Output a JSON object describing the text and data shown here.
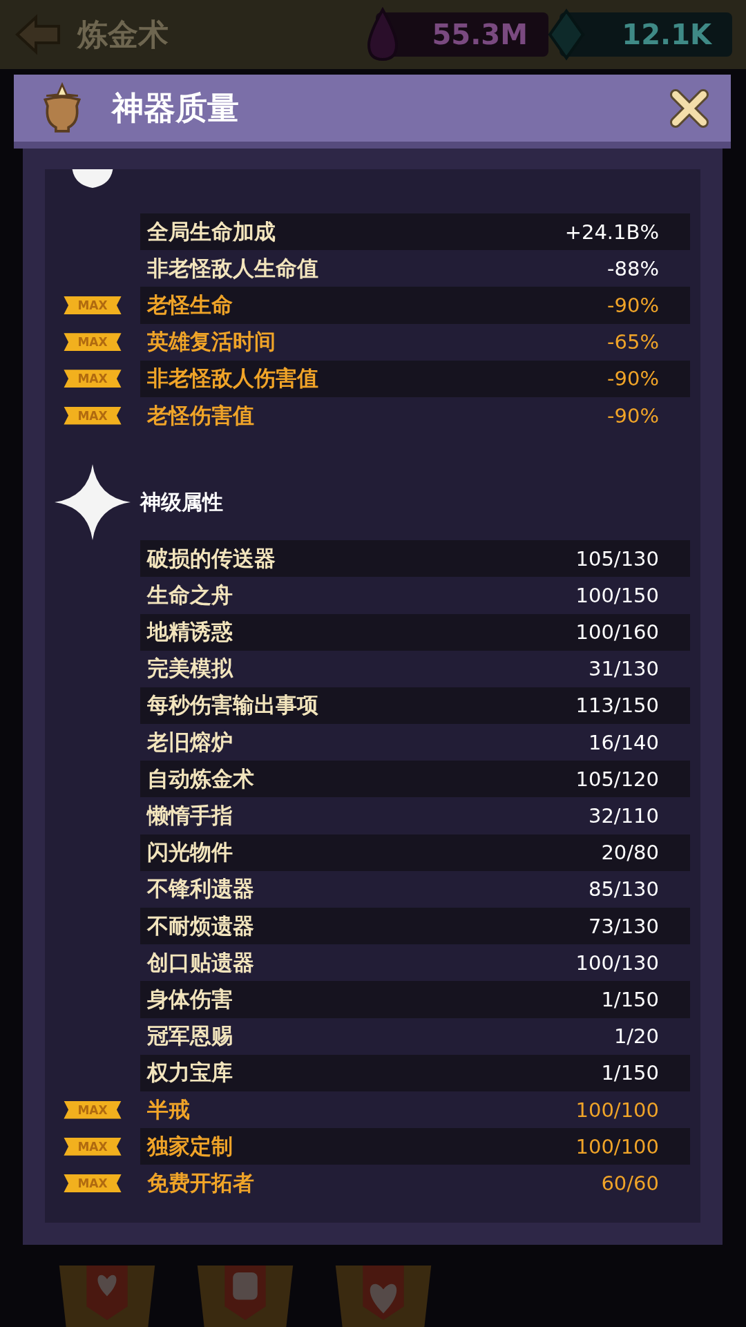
{
  "top_bar": {
    "title": "炼金术",
    "currencies": [
      {
        "kind": "essence",
        "value": "55.3M"
      },
      {
        "kind": "gem",
        "value": "12.1K"
      }
    ]
  },
  "dialog": {
    "title": "神器质量",
    "sections": [
      {
        "kind": "shield",
        "rows": [
          {
            "label": "全局生命加成",
            "value": "+24.1B%",
            "maxed": false
          },
          {
            "label": "非老怪敌人生命值",
            "value": "-88%",
            "maxed": false
          },
          {
            "label": "老怪生命",
            "value": "-90%",
            "maxed": true,
            "badge": "MAX"
          },
          {
            "label": "英雄复活时间",
            "value": "-65%",
            "maxed": true,
            "badge": "MAX"
          },
          {
            "label": "非老怪敌人伤害值",
            "value": "-90%",
            "maxed": true,
            "badge": "MAX"
          },
          {
            "label": "老怪伤害值",
            "value": "-90%",
            "maxed": true,
            "badge": "MAX"
          }
        ]
      },
      {
        "kind": "star",
        "title": "神级属性",
        "rows": [
          {
            "label": "破损的传送器",
            "value": "105/130",
            "maxed": false
          },
          {
            "label": "生命之舟",
            "value": "100/150",
            "maxed": false
          },
          {
            "label": "地精诱惑",
            "value": "100/160",
            "maxed": false
          },
          {
            "label": "完美模拟",
            "value": "31/130",
            "maxed": false
          },
          {
            "label": "每秒伤害输出事项",
            "value": "113/150",
            "maxed": false
          },
          {
            "label": "老旧熔炉",
            "value": "16/140",
            "maxed": false
          },
          {
            "label": "自动炼金术",
            "value": "105/120",
            "maxed": false
          },
          {
            "label": "懒惰手指",
            "value": "32/110",
            "maxed": false
          },
          {
            "label": "闪光物件",
            "value": "20/80",
            "maxed": false
          },
          {
            "label": "不锋利遗器",
            "value": "85/130",
            "maxed": false
          },
          {
            "label": "不耐烦遗器",
            "value": "73/130",
            "maxed": false
          },
          {
            "label": "创口贴遗器",
            "value": "100/130",
            "maxed": false
          },
          {
            "label": "身体伤害",
            "value": "1/150",
            "maxed": false
          },
          {
            "label": "冠军恩赐",
            "value": "1/20",
            "maxed": false
          },
          {
            "label": "权力宝库",
            "value": "1/150",
            "maxed": false
          },
          {
            "label": "半戒",
            "value": "100/100",
            "maxed": true,
            "badge": "MAX"
          },
          {
            "label": "独家定制",
            "value": "100/100",
            "maxed": true,
            "badge": "MAX"
          },
          {
            "label": "免费开拓者",
            "value": "60/60",
            "maxed": true,
            "badge": "MAX"
          }
        ]
      }
    ]
  }
}
